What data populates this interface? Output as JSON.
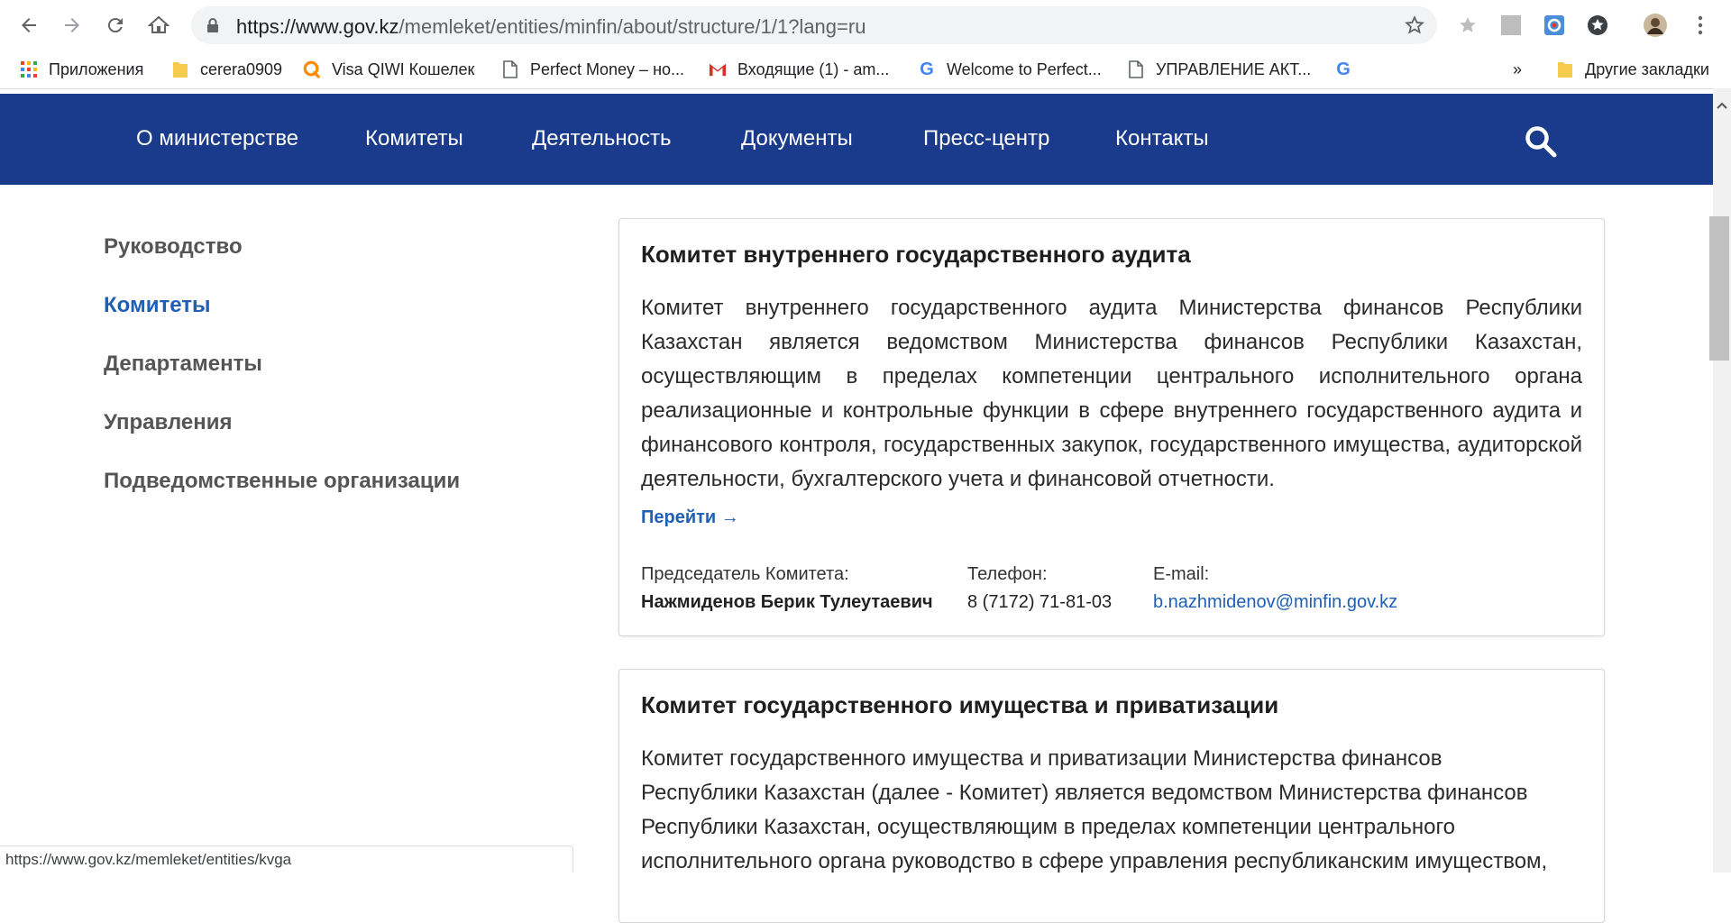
{
  "browser": {
    "url_host": "https://www.gov.kz",
    "url_path": "/memleket/entities/minfin/about/structure/1/1?lang=ru"
  },
  "bookmarks": [
    {
      "label": "Приложения",
      "icon": "apps-grid-icon"
    },
    {
      "label": "cerera0909",
      "icon": "folder-icon"
    },
    {
      "label": "Visa QIWI Кошелек",
      "icon": "qiwi-icon"
    },
    {
      "label": "Perfect Money – но...",
      "icon": "page-icon"
    },
    {
      "label": "Входящие (1) - am...",
      "icon": "gmail-icon"
    },
    {
      "label": "Welcome to Perfect...",
      "icon": "google-icon"
    },
    {
      "label": "УПРАВЛЕНИЕ АКТ...",
      "icon": "page-icon"
    },
    {
      "label": "",
      "icon": "google-icon"
    }
  ],
  "bookmarks_more": "»",
  "other_bookmarks": "Другие закладки",
  "site_menu": [
    {
      "label": "О министерстве"
    },
    {
      "label": "Комитеты"
    },
    {
      "label": "Деятельность"
    },
    {
      "label": "Документы"
    },
    {
      "label": "Пресс-центр"
    },
    {
      "label": "Контакты"
    }
  ],
  "sidebar": [
    {
      "label": "Руководство",
      "active": false
    },
    {
      "label": "Комитеты",
      "active": true
    },
    {
      "label": "Департаменты",
      "active": false
    },
    {
      "label": "Управления",
      "active": false
    },
    {
      "label": "Подведомственные организации",
      "active": false
    }
  ],
  "cards": [
    {
      "title": "Комитет внутреннего государственного аудита",
      "description": "Комитет внутреннего государственного аудита Министерства финансов Республики Казахстан является ведомством Министерства финансов Республики Казахстан, осуществляющим в пределах компетенции центрального исполнительного органа реализационные и контрольные функции в сфере внутреннего государственного аудита и финансового контроля, государственных закупок, государственного имущества, аудиторской деятельности, бухгалтерского учета и финансовой отчетности.",
      "link_label": "Перейти",
      "chairman_label": "Председатель Комитета:",
      "chairman_name": "Нажмиденов Берик Тулеутаевич",
      "phone_label": "Телефон:",
      "phone": "8 (7172) 71-81-03",
      "email_label": "E-mail:",
      "email": "b.nazhmidenov@minfin.gov.kz"
    },
    {
      "title": "Комитет государственного имущества и приватизации",
      "description_lines": [
        "Комитет государственного имущества и приватизации Министерства финансов",
        "Республики Казахстан (далее - Комитет) является ведомством Министерства финансов",
        "Республики Казахстан, осуществляющим в пределах компетенции центрального",
        "исполнительного органа руководство в сфере управления республиканским имуществом,"
      ]
    }
  ],
  "status_url": "https://www.gov.kz/memleket/entities/kvga",
  "colors": {
    "header_bg": "#1a3b8b",
    "link": "#1f5fb5",
    "sidebar_text": "#555555"
  }
}
